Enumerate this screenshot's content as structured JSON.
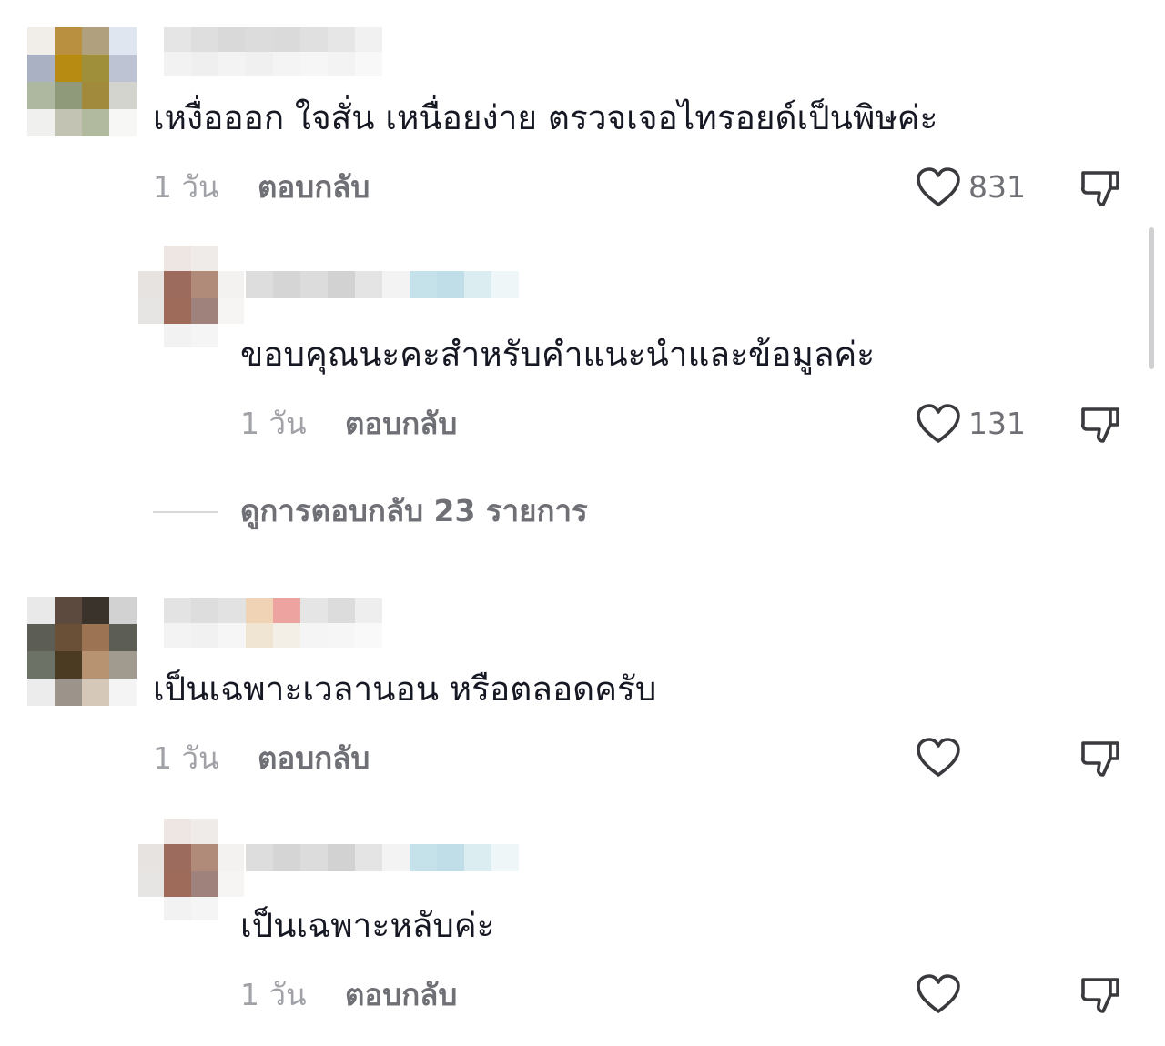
{
  "colors": {
    "text": "#161823",
    "secondary": "#6f7076",
    "time": "#a1a2a7"
  },
  "comments": [
    {
      "text": "เหงื่อออก ใจสั่น เหนื่อยง่าย ตรวจเจอไทรอยด์เป็นพิษค่ะ",
      "time": "1 วัน",
      "reply_label": "ตอบกลับ",
      "likes": "831",
      "like_icon": "heart-outline-icon",
      "dislike_icon": "thumbs-down-icon"
    },
    {
      "text": "ขอบคุณนะคะสำหรับคำแนะนำและข้อมูลค่ะ",
      "time": "1 วัน",
      "reply_label": "ตอบกลับ",
      "likes": "131",
      "like_icon": "heart-outline-icon",
      "dislike_icon": "thumbs-down-icon"
    },
    {
      "text": "เป็นเฉพาะเวลานอน หรือตลอดครับ",
      "time": "1 วัน",
      "reply_label": "ตอบกลับ",
      "likes": "",
      "like_icon": "heart-outline-icon",
      "dislike_icon": "thumbs-down-icon"
    },
    {
      "text": "เป็นเฉพาะหลับค่ะ",
      "time": "1 วัน",
      "reply_label": "ตอบกลับ",
      "likes": "",
      "like_icon": "heart-outline-icon",
      "dislike_icon": "thumbs-down-icon"
    }
  ],
  "view_replies": "ดูการตอบกลับ 23 รายการ"
}
